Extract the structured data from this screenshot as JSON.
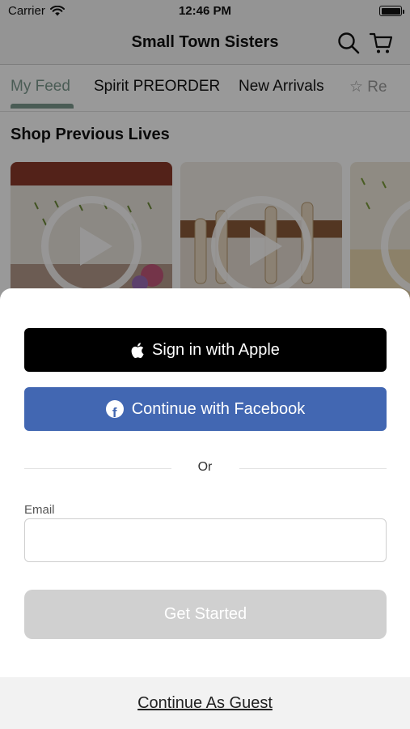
{
  "status_bar": {
    "carrier": "Carrier",
    "time": "12:46 PM"
  },
  "nav": {
    "title": "Small Town Sisters",
    "search_icon": "search-icon",
    "cart_icon": "cart-icon"
  },
  "tabs": [
    {
      "label": "My Feed",
      "active": true
    },
    {
      "label": "Spirit PREORDER",
      "active": false
    },
    {
      "label": "New Arrivals",
      "active": false
    },
    {
      "label": "☆ Re",
      "active": false
    }
  ],
  "section": {
    "title": "Shop Previous Lives"
  },
  "sheet": {
    "apple_button": "Sign in with Apple",
    "facebook_button": "Continue with Facebook",
    "divider_text": "Or",
    "email_label": "Email",
    "email_value": "",
    "email_placeholder": "",
    "get_started": "Get Started",
    "guest_link": "Continue As Guest"
  },
  "colors": {
    "accent": "#7c9a8e",
    "facebook": "#4267b2",
    "apple": "#000000",
    "disabled": "#d0d0d0"
  }
}
